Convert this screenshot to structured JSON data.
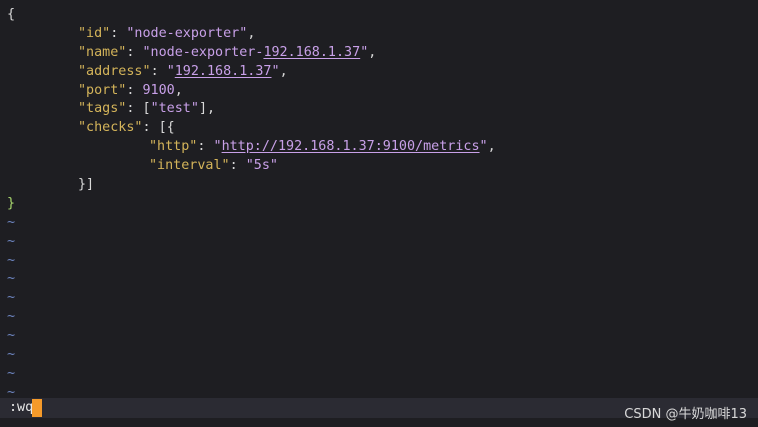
{
  "editor": {
    "open_brace": "{",
    "close_brace": "}",
    "id_key": "\"id\"",
    "id_value": "\"node-exporter\"",
    "name_key": "\"name\"",
    "name_value_prefix": "\"node-exporter-",
    "name_value_link": "192.168.1.37",
    "name_value_suffix": "\"",
    "address_key": "\"address\"",
    "address_value_prefix": "\"",
    "address_value_link": "192.168.1.37",
    "address_value_suffix": "\"",
    "port_key": "\"port\"",
    "port_value": "9100",
    "tags_key": "\"tags\"",
    "tags_value": "\"test\"",
    "checks_key": "\"checks\"",
    "checks_open": "[{",
    "http_key": "\"http\"",
    "http_value_prefix": "\"",
    "http_value_link": "http://192.168.1.37:9100/metrics",
    "http_value_suffix": "\"",
    "interval_key": "\"interval\"",
    "interval_value": "\"5s\"",
    "checks_close": "}]",
    "tilde": "~"
  },
  "statusbar": {
    "command": ":wq"
  },
  "watermark": {
    "text": "CSDN @牛奶咖啡13"
  },
  "colors": {
    "background": "#1e1e22",
    "key": "#d4b45a",
    "string": "#c8a0e8",
    "tilde": "#6e86c2",
    "closing_brace": "#a9d86e",
    "cursor": "#f59a2a"
  }
}
